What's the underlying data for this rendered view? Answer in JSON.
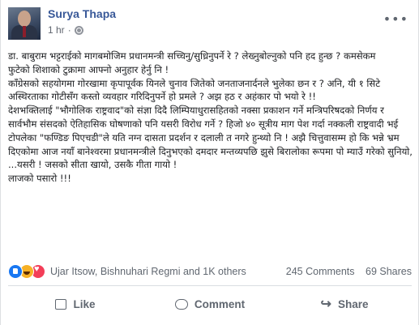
{
  "post": {
    "author": "Surya Thapa",
    "time": "1 hr",
    "separator": "·",
    "paragraphs": [
      "डा. बाबुराम भट्टराईको मागबमोजिम प्रधानमन्त्री सच्चिनु/सुध्रिनुपर्ने रे ? लेख्नुबोल्नुको पनि हद हुन्छ ? कमसेकम",
      "फुटेको शिशाको टुक्रामा आफ्नो अनुहार हेर्नु नि !",
      "काँग्रेसको सहयोगमा गोरखामा कृपापूर्वक यिनले चुनाव जितेको जनताजनार्दनले भुलेका छन र ? अनि, यी १ सिटे अस्थिरताका गोटीसँग कस्तो व्यवहार गरिदिनुपर्ने हो प्रमले ? अझ हठ र अहंकार पो भयो रे !!",
      "देशभक्तिलाई \"भौगोलिक राष्ट्रवाद\"को संज्ञा दिदै लिम्पियाधुरासहितको नक्सा प्रकाशन गर्ने मन्त्रिपरिषदको निर्णय र सार्वभौम संसदको ऐतिहासिक घोषणाको पनि यसरी विरोध गर्ने ? हिजो ४० सूत्रीय माग पेश गर्दा नक्कली राष्ट्रवादी भई टोपलेका \"फण्डिङ पिएचडी\"ले यति नग्न दासता प्रदर्शन र दलाली त नगरे हुन्थ्यो नि ! अझै चित्तुवासम्म हो कि भन्ने भ्रम दिएकोमा आज नयाँ बानेश्वरमा प्रधानमन्त्रीले दिनुभएको दमदार मन्तव्यपछि झुसे बिरालोका रूपमा पो म्याउँ गरेको सुनियो, ...यसरी ! जसको सीता खायो, उसकै गीता गायो !",
      "लाजको पसारो !!!"
    ],
    "reactions": {
      "names": "Ujar Itsow, Bishnuhari Regmi and 1K others",
      "comments": "245 Comments",
      "shares": "69 Shares",
      "icons": [
        "like-icon",
        "haha-icon",
        "love-icon"
      ]
    },
    "actions": {
      "like": "Like",
      "comment": "Comment",
      "share": "Share"
    },
    "colors": {
      "author": "#385898",
      "meta": "#616770",
      "like_blue": "#1877f2"
    }
  }
}
